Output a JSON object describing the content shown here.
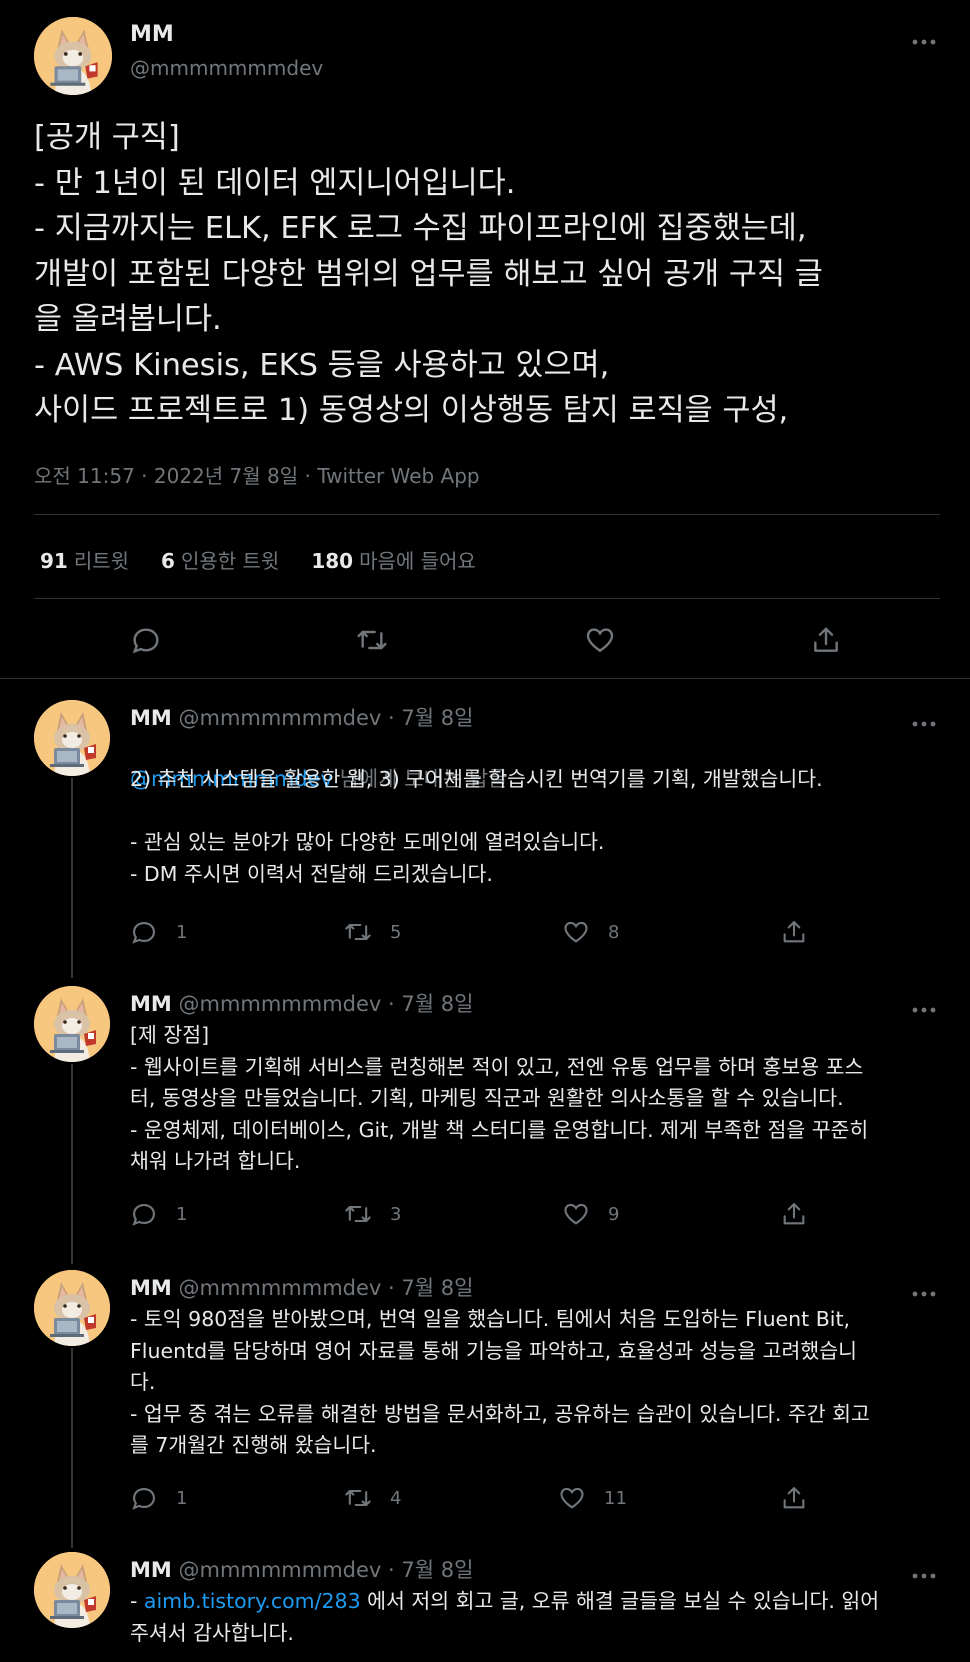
{
  "main_tweet": {
    "display_name": "MM",
    "handle": "@mmmmmmmdev",
    "more_icon": "more-dots-icon",
    "text": "[공개 구직]\n- 만 1년이 된 데이터 엔지니어입니다.\n- 지금까지는 ELK, EFK 로그 수집 파이프라인에 집중했는데,\n개발이 포함된 다양한 범위의 업무를 해보고 싶어 공개 구직 글\n을 올려봅니다.\n- AWS Kinesis, EKS 등을 사용하고 있으며,\n사이드 프로젝트로 1) 동영상의 이상행동 탐지 로직을 구성,",
    "meta": "오전 11:57 · 2022년 7월 8일 · Twitter Web App",
    "stats": [
      {
        "count": "91",
        "label": "리트윗"
      },
      {
        "count": "6",
        "label": "인용한 트윗"
      },
      {
        "count": "180",
        "label": "마음에 들어요"
      }
    ],
    "actions": [
      "reply-icon",
      "retweet-icon",
      "like-icon",
      "share-icon"
    ]
  },
  "replies": [
    {
      "display_name": "MM",
      "handle_date": "@mmmmmmmdev · 7월 8일",
      "replying_to_handle": "@mmmmmmmdev",
      "replying_to_suffix": " 님에게 보내는 답글",
      "text": "2) 추천 시스템을 활용한 웹, 3) 구어체를 학습시킨 번역기를 기획, 개발했습니다.\n\n- 관심 있는 분야가 많아 다양한 도메인에 열려있습니다.\n- DM 주시면 이력서 전달해 드리겠습니다.",
      "replies": "1",
      "retweets": "5",
      "likes": "8"
    },
    {
      "display_name": "MM",
      "handle_date": "@mmmmmmmdev · 7월 8일",
      "text": "[제 장점]\n- 웹사이트를 기획해 서비스를 런칭해본 적이 있고, 전엔 유통 업무를 하며 홍보용 포스\n터, 동영상을 만들었습니다. 기획, 마케팅 직군과 원활한 의사소통을 할 수 있습니다.\n- 운영체제, 데이터베이스, Git, 개발 책 스터디를 운영합니다. 제게 부족한 점을 꾸준히\n채워 나가려 합니다.",
      "replies": "1",
      "retweets": "3",
      "likes": "9"
    },
    {
      "display_name": "MM",
      "handle_date": "@mmmmmmmdev · 7월 8일",
      "text": "- 토익 980점을 받아봤으며, 번역 일을 했습니다. 팀에서 처음 도입하는 Fluent Bit,\nFluentd를 담당하며 영어 자료를 통해 기능을 파악하고, 효율성과 성능을 고려했습니\n다.\n- 업무 중 겪는 오류를 해결한 방법을 문서화하고, 공유하는 습관이 있습니다. 주간 회고\n를 7개월간 진행해 왔습니다.",
      "replies": "1",
      "retweets": "4",
      "likes": "11"
    },
    {
      "display_name": "MM",
      "handle_date": "@mmmmmmmdev · 7월 8일",
      "text_prefix": "- ",
      "link": "aimb.tistory.com/283",
      "text_suffix": " 에서 저의 회고 글, 오류 해결 글들을 보실 수 있습니다. 읽어\n주셔서 감사합니다."
    }
  ],
  "colors": {
    "background": "#000000",
    "text": "#e7e9ea",
    "secondary": "#71767b",
    "link": "#1d9bf0",
    "divider": "#2f3336",
    "avatar_bg": "#f7c77f"
  }
}
